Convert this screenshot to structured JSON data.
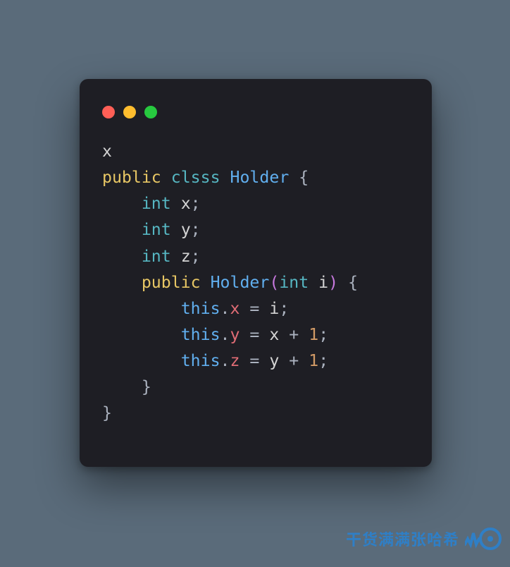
{
  "window": {
    "traffic_lights": {
      "red": "close-icon",
      "yellow": "minimize-icon",
      "green": "zoom-icon"
    }
  },
  "code": {
    "language": "java",
    "lines": [
      {
        "indent": 0,
        "tokens": [
          {
            "t": "x",
            "c": "id"
          }
        ]
      },
      {
        "indent": 0,
        "tokens": [
          {
            "t": "public",
            "c": "kw"
          },
          {
            "t": " ",
            "c": ""
          },
          {
            "t": "clsss",
            "c": "type"
          },
          {
            "t": " ",
            "c": ""
          },
          {
            "t": "Holder",
            "c": "cls"
          },
          {
            "t": " ",
            "c": ""
          },
          {
            "t": "{",
            "c": "punct"
          }
        ]
      },
      {
        "indent": 1,
        "tokens": [
          {
            "t": "int",
            "c": "type"
          },
          {
            "t": " ",
            "c": ""
          },
          {
            "t": "x",
            "c": "id"
          },
          {
            "t": ";",
            "c": "punct"
          }
        ]
      },
      {
        "indent": 1,
        "tokens": [
          {
            "t": "int",
            "c": "type"
          },
          {
            "t": " ",
            "c": ""
          },
          {
            "t": "y",
            "c": "id"
          },
          {
            "t": ";",
            "c": "punct"
          }
        ]
      },
      {
        "indent": 1,
        "tokens": [
          {
            "t": "int",
            "c": "type"
          },
          {
            "t": " ",
            "c": ""
          },
          {
            "t": "z",
            "c": "id"
          },
          {
            "t": ";",
            "c": "punct"
          }
        ]
      },
      {
        "indent": 1,
        "tokens": [
          {
            "t": "public",
            "c": "kw"
          },
          {
            "t": " ",
            "c": ""
          },
          {
            "t": "Holder",
            "c": "cls"
          },
          {
            "t": "(",
            "c": "paren"
          },
          {
            "t": "int",
            "c": "type"
          },
          {
            "t": " ",
            "c": ""
          },
          {
            "t": "i",
            "c": "id"
          },
          {
            "t": ")",
            "c": "paren"
          },
          {
            "t": " ",
            "c": ""
          },
          {
            "t": "{",
            "c": "punct"
          }
        ]
      },
      {
        "indent": 2,
        "tokens": [
          {
            "t": "this",
            "c": "this"
          },
          {
            "t": ".",
            "c": "punct"
          },
          {
            "t": "x",
            "c": "field"
          },
          {
            "t": " = ",
            "c": "op"
          },
          {
            "t": "i",
            "c": "id"
          },
          {
            "t": ";",
            "c": "punct"
          }
        ]
      },
      {
        "indent": 2,
        "tokens": [
          {
            "t": "this",
            "c": "this"
          },
          {
            "t": ".",
            "c": "punct"
          },
          {
            "t": "y",
            "c": "field"
          },
          {
            "t": " = ",
            "c": "op"
          },
          {
            "t": "x",
            "c": "id"
          },
          {
            "t": " + ",
            "c": "op"
          },
          {
            "t": "1",
            "c": "num"
          },
          {
            "t": ";",
            "c": "punct"
          }
        ]
      },
      {
        "indent": 2,
        "tokens": [
          {
            "t": "this",
            "c": "this"
          },
          {
            "t": ".",
            "c": "punct"
          },
          {
            "t": "z",
            "c": "field"
          },
          {
            "t": " = ",
            "c": "op"
          },
          {
            "t": "y",
            "c": "id"
          },
          {
            "t": " + ",
            "c": "op"
          },
          {
            "t": "1",
            "c": "num"
          },
          {
            "t": ";",
            "c": "punct"
          }
        ]
      },
      {
        "indent": 1,
        "tokens": [
          {
            "t": "}",
            "c": "punct"
          }
        ]
      },
      {
        "indent": 0,
        "tokens": [
          {
            "t": "}",
            "c": "punct"
          }
        ]
      }
    ],
    "indent_unit": "    "
  },
  "watermark": {
    "text": "干货满满张哈希"
  }
}
